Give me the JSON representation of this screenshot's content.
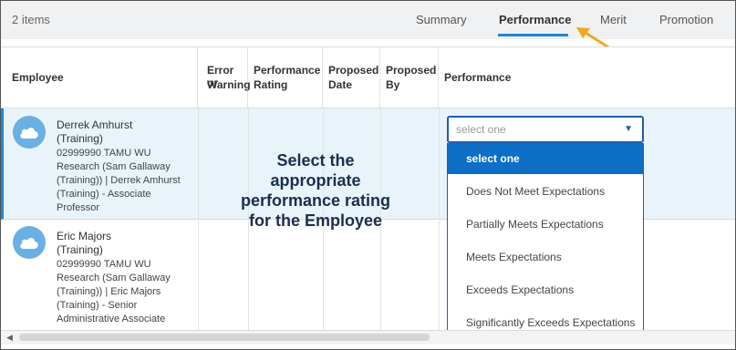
{
  "toolbar": {
    "items_count": "2 items"
  },
  "tabs": [
    {
      "label": "Summary"
    },
    {
      "label": "Performance"
    },
    {
      "label": "Merit"
    },
    {
      "label": "Promotion"
    }
  ],
  "columns": {
    "employee": "Employee",
    "error_line1": "Error or",
    "error_line2": "Warning",
    "rating_line1": "Performance",
    "rating_line2": "Rating",
    "date_line1": "Proposed",
    "date_line2": "Date",
    "by_line1": "Proposed",
    "by_line2": "By",
    "performance": "Performance"
  },
  "rows": [
    {
      "name_line1": "Derrek Amhurst",
      "name_line2": "(Training)",
      "detail": [
        "02999990 TAMU WU",
        "Research (Sam Gallaway",
        "(Training)) | Derrek Amhurst",
        "(Training) - Associate",
        "Professor"
      ]
    },
    {
      "name_line1": "Eric Majors",
      "name_line2": "(Training)",
      "detail": [
        "02999990 TAMU WU",
        "Research (Sam Gallaway",
        "(Training)) | Eric Majors",
        "(Training) - Senior",
        "Administrative Associate"
      ]
    }
  ],
  "callout": [
    "Select the",
    "appropriate",
    "performance rating",
    "for the Employee"
  ],
  "select": {
    "placeholder": "select one",
    "options": [
      "select one",
      "Does Not Meet Expectations",
      "Partially Meets Expectations",
      "Meets Expectations",
      "Exceeds Expectations",
      "Significantly Exceeds Expectations"
    ]
  },
  "colors": {
    "accent": "#1e88d6",
    "arrow": "#f0a81e",
    "selected_option": "#0d6ec6"
  },
  "icons": {
    "avatar": "cloud-icon",
    "caret": "caret-down-icon",
    "scroll": "scroll-left-icon"
  }
}
